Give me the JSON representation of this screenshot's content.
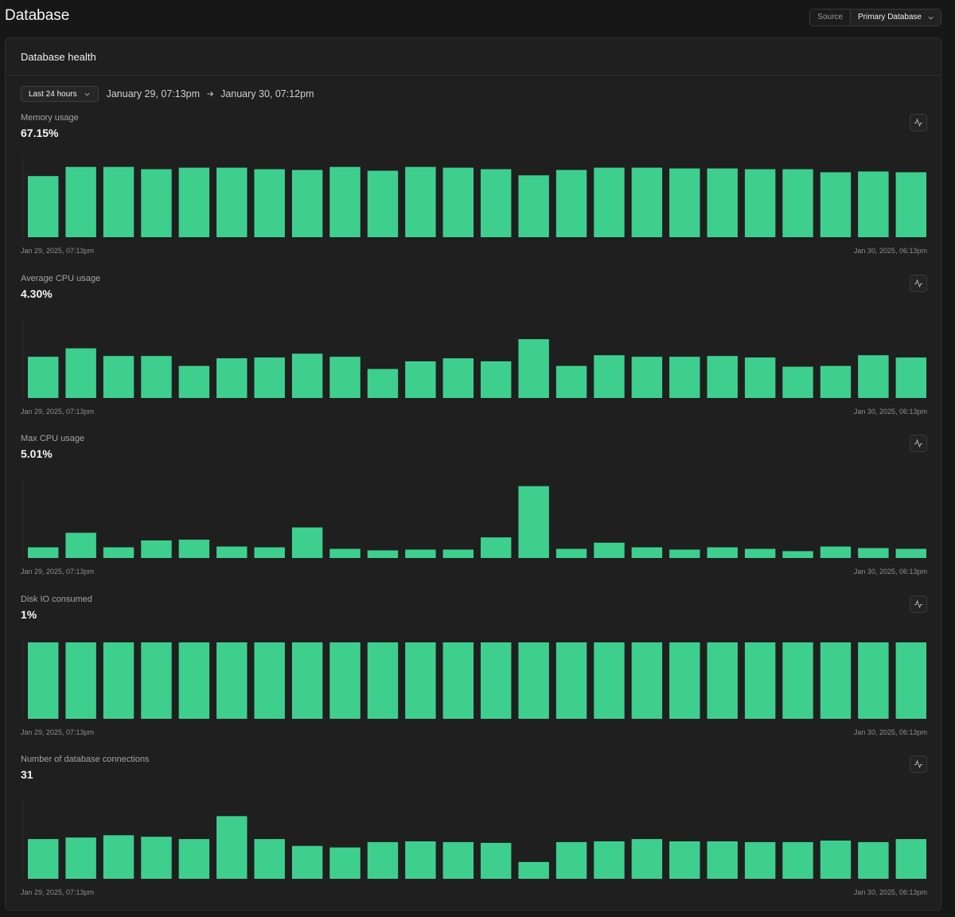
{
  "page": {
    "title": "Database"
  },
  "source": {
    "label": "Source",
    "value": "Primary Database"
  },
  "panel": {
    "title": "Database health"
  },
  "range": {
    "button_label": "Last 24 hours",
    "start": "January 29, 07:13pm",
    "end": "January 30, 07:12pm"
  },
  "colors": {
    "bar": "#3ecf8e",
    "background": "#1f1f1f"
  },
  "chart_data": [
    {
      "type": "bar",
      "title": "Memory usage",
      "value": "67.15%",
      "x_start_label": "Jan 29, 2025, 07:13pm",
      "x_end_label": "Jan 30, 2025, 06:13pm",
      "values": [
        80,
        92,
        92,
        89,
        91,
        91,
        89,
        88,
        92,
        87,
        92,
        91,
        89,
        81,
        88,
        91,
        91,
        90,
        90,
        89,
        89,
        85,
        86,
        85
      ],
      "ylim": [
        0,
        100
      ]
    },
    {
      "type": "bar",
      "title": "Average CPU usage",
      "value": "4.30%",
      "x_start_label": "Jan 29, 2025, 07:13pm",
      "x_end_label": "Jan 30, 2025, 06:13pm",
      "values": [
        54,
        65,
        55,
        55,
        42,
        52,
        53,
        58,
        54,
        38,
        48,
        52,
        48,
        77,
        42,
        56,
        54,
        54,
        55,
        53,
        41,
        42,
        56,
        53
      ],
      "ylim": [
        0,
        100
      ]
    },
    {
      "type": "bar",
      "title": "Max CPU usage",
      "value": "5.01%",
      "x_start_label": "Jan 29, 2025, 07:13pm",
      "x_end_label": "Jan 30, 2025, 06:13pm",
      "values": [
        14,
        33,
        14,
        23,
        24,
        15,
        14,
        40,
        12,
        10,
        11,
        11,
        27,
        94,
        12,
        20,
        14,
        11,
        14,
        12,
        9,
        15,
        13,
        12
      ],
      "ylim": [
        0,
        100
      ]
    },
    {
      "type": "bar",
      "title": "Disk IO consumed",
      "value": "1%",
      "x_start_label": "Jan 29, 2025, 07:13pm",
      "x_end_label": "Jan 30, 2025, 06:13pm",
      "values": [
        100,
        100,
        100,
        100,
        100,
        100,
        100,
        100,
        100,
        100,
        100,
        100,
        100,
        100,
        100,
        100,
        100,
        100,
        100,
        100,
        100,
        100,
        100,
        100
      ],
      "ylim": [
        0,
        100
      ]
    },
    {
      "type": "bar",
      "title": "Number of database connections",
      "value": "31",
      "x_start_label": "Jan 29, 2025, 07:13pm",
      "x_end_label": "Jan 30, 2025, 06:13pm",
      "values": [
        52,
        54,
        57,
        55,
        52,
        82,
        52,
        43,
        41,
        48,
        49,
        48,
        47,
        22,
        48,
        49,
        52,
        49,
        49,
        48,
        48,
        50,
        48,
        52
      ],
      "ylim": [
        0,
        100
      ]
    }
  ]
}
